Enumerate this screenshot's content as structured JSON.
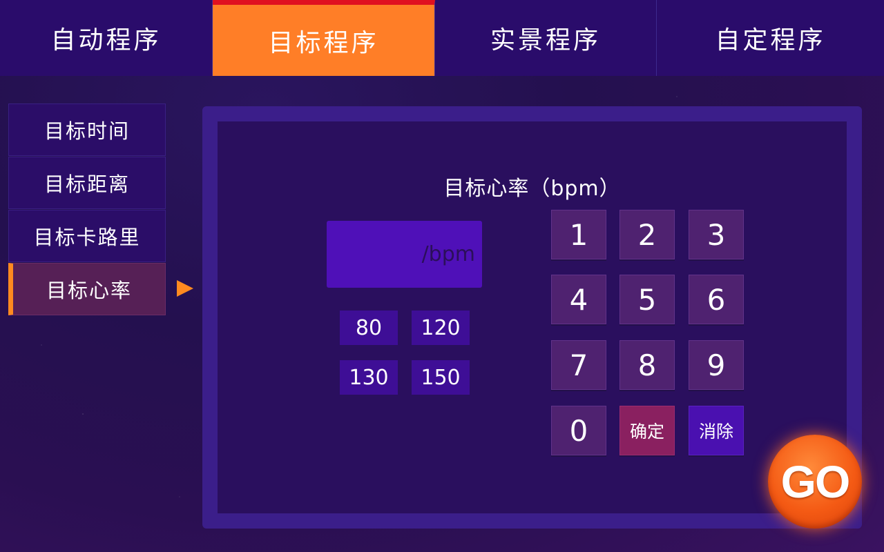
{
  "tabs": [
    {
      "label": "自动程序"
    },
    {
      "label": "目标程序"
    },
    {
      "label": "实景程序"
    },
    {
      "label": "自定程序"
    }
  ],
  "sidebar": {
    "items": [
      {
        "label": "目标时间"
      },
      {
        "label": "目标距离"
      },
      {
        "label": "目标卡路里"
      },
      {
        "label": "目标心率"
      }
    ]
  },
  "panel": {
    "title": "目标心率（bpm）",
    "display_unit": "/bpm",
    "presets": [
      "80",
      "120",
      "130",
      "150"
    ],
    "keypad": {
      "digits": [
        "1",
        "2",
        "3",
        "4",
        "5",
        "6",
        "7",
        "8",
        "9",
        "0"
      ],
      "confirm_label": "确定",
      "clear_label": "消除"
    }
  },
  "go_label": "GO",
  "colors": {
    "active_tab": "#ff7e27",
    "active_tab_accent": "#e01020",
    "accent_orange": "#ff8a20",
    "display_bg": "#4f10b8",
    "go_button": "#f45a14"
  }
}
